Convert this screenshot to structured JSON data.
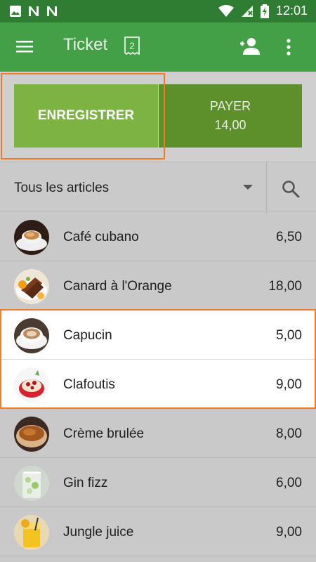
{
  "status_bar": {
    "time": "12:01"
  },
  "app_bar": {
    "title": "Ticket",
    "ticket_count": "2"
  },
  "actions": {
    "save_label": "ENREGISTRER",
    "pay_label": "PAYER",
    "pay_amount": "14,00"
  },
  "filter": {
    "category": "Tous les articles"
  },
  "items": [
    {
      "name": "Café cubano",
      "price": "6,50"
    },
    {
      "name": "Canard à l'Orange",
      "price": "18,00"
    },
    {
      "name": "Capucin",
      "price": "5,00"
    },
    {
      "name": "Clafoutis",
      "price": "9,00"
    },
    {
      "name": "Crème brulée",
      "price": "8,00"
    },
    {
      "name": "Gin fizz",
      "price": "6,00"
    },
    {
      "name": "Jungle juice",
      "price": "9,00"
    }
  ],
  "colors": {
    "status_bar": "#2e7d32",
    "app_bar": "#43a047",
    "save_button": "#7cb342",
    "pay_button": "#5d8f2b",
    "highlight": "#f57c24"
  }
}
